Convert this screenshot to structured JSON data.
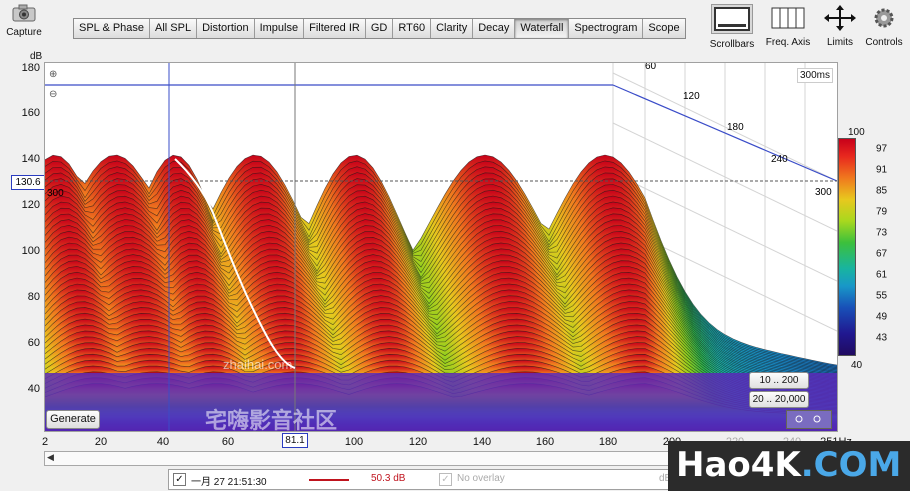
{
  "toolbar": {
    "capture_label": "Capture",
    "tabs": [
      "SPL & Phase",
      "All SPL",
      "Distortion",
      "Impulse",
      "Filtered IR",
      "GD",
      "RT60",
      "Clarity",
      "Decay",
      "Waterfall",
      "Spectrogram",
      "Scope"
    ],
    "active_tab": "Waterfall",
    "tools": {
      "scrollbars": "Scrollbars",
      "freq_axis": "Freq. Axis",
      "limits": "Limits",
      "controls": "Controls"
    }
  },
  "plot": {
    "y_unit": "dB",
    "y_ticks": [
      "180",
      "160",
      "140",
      "120",
      "100",
      "80",
      "60",
      "40"
    ],
    "x_ticks": [
      "2",
      "20",
      "40",
      "60",
      "80",
      "100",
      "120",
      "140",
      "160",
      "180",
      "200",
      "220",
      "240",
      "251Hz"
    ],
    "cursor_y": "130.6",
    "cursor_x": "81.1",
    "time_label": "300ms",
    "depth_ticks": [
      "60",
      "120",
      "180",
      "240",
      "300"
    ],
    "left_time_label": "300",
    "generate_label": "Generate",
    "range_buttons": [
      "10 .. 200",
      "20 .. 20,000"
    ],
    "watermark_url": "zhaihai.com",
    "watermark_cn": "宅嗨影音社区"
  },
  "color_scale": {
    "max": "100",
    "min": "40",
    "ticks": [
      "97",
      "91",
      "85",
      "79",
      "73",
      "67",
      "61",
      "55",
      "49",
      "43"
    ]
  },
  "legend": {
    "checked": "✓",
    "measurement": "一月 27 21:51:30",
    "line_color": "#c0141e",
    "level": "50.3 dB",
    "overlay": "No overlay",
    "overlay_unit": "dB"
  },
  "brand": {
    "text1": "Hao4K",
    "text2": ".COM"
  }
}
